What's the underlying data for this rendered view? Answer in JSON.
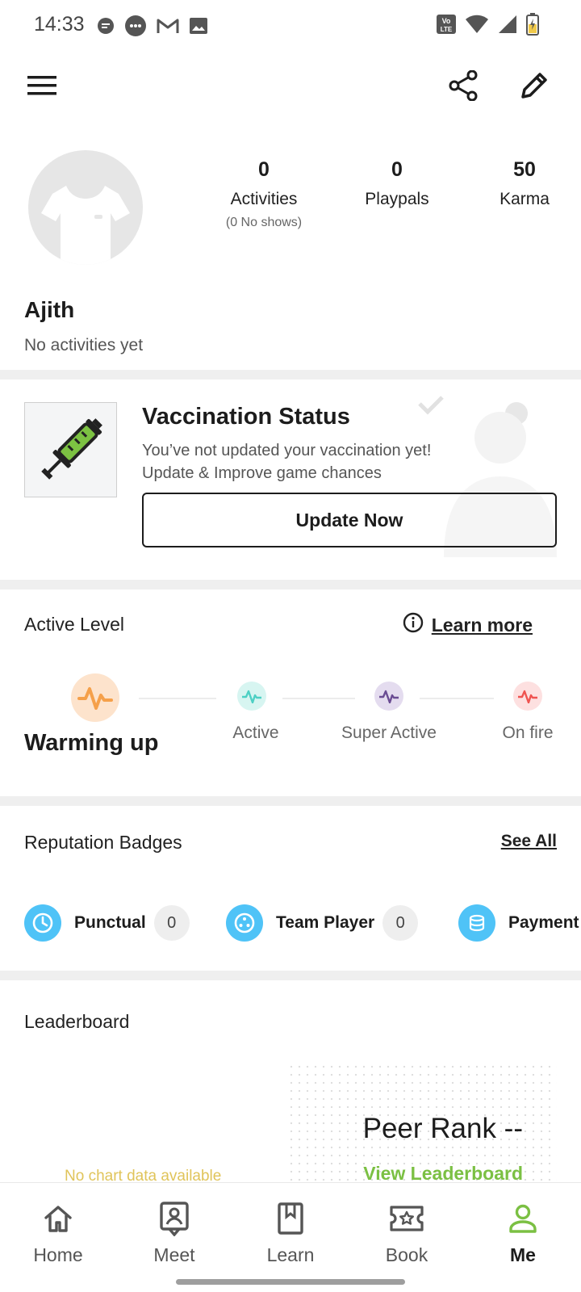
{
  "status_bar": {
    "time": "14:33",
    "left_icons": [
      "message-icon",
      "chat-icon",
      "gmail-icon",
      "image-icon"
    ],
    "right_icons": [
      "volte-icon",
      "wifi-icon",
      "signal-icon",
      "battery-charging-icon"
    ],
    "volte_text": "Vo LTE"
  },
  "toolbar": {
    "menu_icon": "menu-icon",
    "share_icon": "share-icon",
    "edit_icon": "edit-icon"
  },
  "profile": {
    "name": "Ajith",
    "subtitle": "No activities yet",
    "stats": [
      {
        "value": "0",
        "label": "Activities",
        "sub": "(0 No shows)"
      },
      {
        "value": "0",
        "label": "Playpals",
        "sub": ""
      },
      {
        "value": "50",
        "label": "Karma",
        "sub": ""
      }
    ]
  },
  "vaccination": {
    "title": "Vaccination Status",
    "line1": "You’ve not updated your vaccination yet!",
    "line2": "Update & Improve game chances",
    "button": "Update Now"
  },
  "active_level": {
    "title": "Active Level",
    "learn_more": "Learn more",
    "current": "Warming up",
    "levels": [
      {
        "label": "Active",
        "color": "#4dd0c4"
      },
      {
        "label": "Super Active",
        "color": "#6a4c93"
      },
      {
        "label": "On fire",
        "color": "#ef5350"
      }
    ],
    "current_color": "#f5a04a"
  },
  "badges": {
    "title": "Reputation Badges",
    "see_all": "See All",
    "items": [
      {
        "label": "Punctual",
        "count": "0",
        "icon": "clock-icon"
      },
      {
        "label": "Team Player",
        "count": "0",
        "icon": "team-icon"
      },
      {
        "label": "Payment",
        "icon": "coins-icon"
      }
    ]
  },
  "leaderboard": {
    "title": "Leaderboard",
    "peer_rank": "Peer Rank --",
    "view_link": "View Leaderboard",
    "no_chart": "No chart data available"
  },
  "nav": {
    "items": [
      {
        "label": "Home",
        "icon": "home-icon"
      },
      {
        "label": "Meet",
        "icon": "meet-icon"
      },
      {
        "label": "Learn",
        "icon": "learn-icon"
      },
      {
        "label": "Book",
        "icon": "book-icon"
      },
      {
        "label": "Me",
        "icon": "me-icon"
      }
    ],
    "active_color": "#7bc043"
  }
}
